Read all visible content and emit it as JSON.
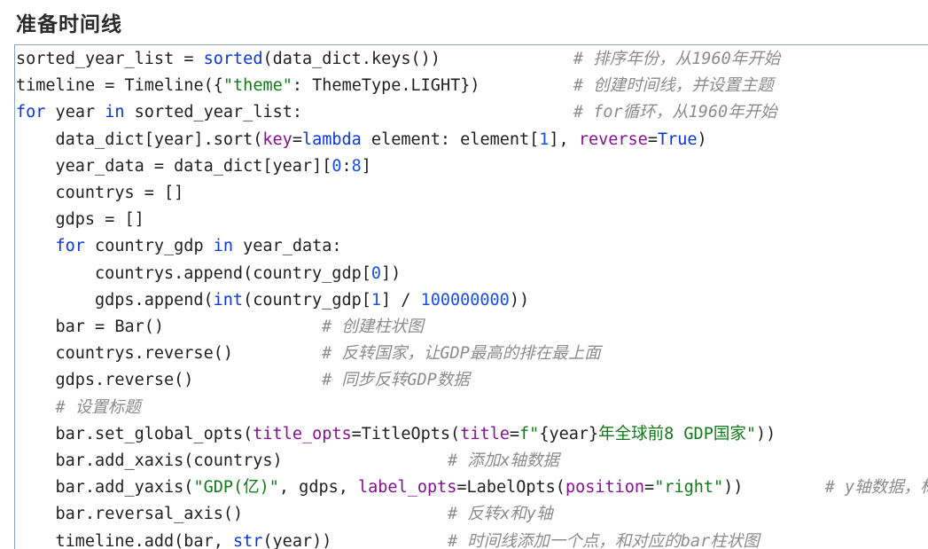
{
  "section_title": "准备时间线",
  "code_lines": [
    {
      "indent": 0,
      "tokens": [
        [
          "p",
          "sorted_year_list = "
        ],
        [
          "kw",
          "sorted"
        ],
        [
          "p",
          "(data_dict.keys())"
        ]
      ],
      "comment": "# 排序年份，从1960年开始",
      "comment_col": 65
    },
    {
      "indent": 0,
      "tokens": [
        [
          "p",
          "timeline = Timeline({"
        ],
        [
          "str",
          "\"theme\""
        ],
        [
          "p",
          ": ThemeType.LIGHT})"
        ]
      ],
      "comment": "# 创建时间线，并设置主题",
      "comment_col": 65
    },
    {
      "indent": 0,
      "tokens": [
        [
          "kw",
          "for"
        ],
        [
          "p",
          " year "
        ],
        [
          "kw",
          "in"
        ],
        [
          "p",
          " sorted_year_list:"
        ]
      ],
      "comment": "# for循环，从1960年开始",
      "comment_col": 65
    },
    {
      "indent": 1,
      "tokens": [
        [
          "p",
          "data_dict[year].sort("
        ],
        [
          "kwarg",
          "key"
        ],
        [
          "p",
          "="
        ],
        [
          "kw",
          "lambda"
        ],
        [
          "p",
          " element: element["
        ],
        [
          "num",
          "1"
        ],
        [
          "p",
          "], "
        ],
        [
          "kwarg",
          "reverse"
        ],
        [
          "p",
          "="
        ],
        [
          "kw",
          "True"
        ],
        [
          "p",
          ")"
        ]
      ],
      "comment": "",
      "comment_col": 0
    },
    {
      "indent": 1,
      "tokens": [
        [
          "p",
          "year_data = data_dict[year]["
        ],
        [
          "num",
          "0"
        ],
        [
          "p",
          ":"
        ],
        [
          "num",
          "8"
        ],
        [
          "p",
          "]"
        ]
      ],
      "comment": "",
      "comment_col": 0
    },
    {
      "indent": 1,
      "tokens": [
        [
          "p",
          "countrys = []"
        ]
      ],
      "comment": "",
      "comment_col": 0
    },
    {
      "indent": 1,
      "tokens": [
        [
          "p",
          "gdps = []"
        ]
      ],
      "comment": "",
      "comment_col": 0
    },
    {
      "indent": 1,
      "tokens": [
        [
          "kw",
          "for"
        ],
        [
          "p",
          " country_gdp "
        ],
        [
          "kw",
          "in"
        ],
        [
          "p",
          " year_data:"
        ]
      ],
      "comment": "",
      "comment_col": 0
    },
    {
      "indent": 2,
      "tokens": [
        [
          "p",
          "countrys.append(country_gdp["
        ],
        [
          "num",
          "0"
        ],
        [
          "p",
          "])"
        ]
      ],
      "comment": "",
      "comment_col": 0
    },
    {
      "indent": 2,
      "tokens": [
        [
          "p",
          "gdps.append("
        ],
        [
          "kw",
          "int"
        ],
        [
          "p",
          "(country_gdp["
        ],
        [
          "num",
          "1"
        ],
        [
          "p",
          "] / "
        ],
        [
          "num",
          "100000000"
        ],
        [
          "p",
          "))"
        ]
      ],
      "comment": "",
      "comment_col": 0
    },
    {
      "indent": 1,
      "tokens": [
        [
          "p",
          "bar = Bar()"
        ]
      ],
      "comment": "# 创建柱状图",
      "comment_col": 35
    },
    {
      "indent": 1,
      "tokens": [
        [
          "p",
          "countrys.reverse()"
        ]
      ],
      "comment": "# 反转国家，让GDP最高的排在最上面",
      "comment_col": 35
    },
    {
      "indent": 1,
      "tokens": [
        [
          "p",
          "gdps.reverse()"
        ]
      ],
      "comment": "# 同步反转GDP数据",
      "comment_col": 35
    },
    {
      "indent": 1,
      "tokens": [
        [
          "cmt",
          "# 设置标题"
        ]
      ],
      "comment": "",
      "comment_col": 0
    },
    {
      "indent": 1,
      "tokens": [
        [
          "p",
          "bar.set_global_opts("
        ],
        [
          "kwarg",
          "title_opts"
        ],
        [
          "p",
          "=TitleOpts("
        ],
        [
          "kwarg",
          "title"
        ],
        [
          "p",
          "="
        ],
        [
          "str",
          "f\""
        ],
        [
          "p",
          "{year}"
        ],
        [
          "str",
          "年全球前8 GDP国家\""
        ],
        [
          "p",
          "))"
        ]
      ],
      "comment": "",
      "comment_col": 0
    },
    {
      "indent": 1,
      "tokens": [
        [
          "p",
          "bar.add_xaxis(countrys)"
        ]
      ],
      "comment": "# 添加x轴数据",
      "comment_col": 50
    },
    {
      "indent": 1,
      "tokens": [
        [
          "p",
          "bar.add_yaxis("
        ],
        [
          "str",
          "\"GDP(亿)\""
        ],
        [
          "p",
          ", gdps, "
        ],
        [
          "kwarg",
          "label_opts"
        ],
        [
          "p",
          "=LabelOpts("
        ],
        [
          "kwarg",
          "position"
        ],
        [
          "p",
          "="
        ],
        [
          "str",
          "\"right\""
        ],
        [
          "p",
          "))"
        ]
      ],
      "comment": "# y轴数据，标签在右",
      "comment_col": 95
    },
    {
      "indent": 1,
      "tokens": [
        [
          "p",
          "bar.reversal_axis()"
        ]
      ],
      "comment": "# 反转x和y轴",
      "comment_col": 50
    },
    {
      "indent": 1,
      "tokens": [
        [
          "p",
          "timeline.add(bar, "
        ],
        [
          "kw",
          "str"
        ],
        [
          "p",
          "(year))"
        ]
      ],
      "comment": "# 时间线添加一个点，和对应的bar柱状图",
      "comment_col": 50
    }
  ],
  "colors": {
    "keyword": "#0a37d9",
    "string": "#117a1a",
    "number": "#1750eb",
    "kwarg": "#871094",
    "comment": "#8c8c8c",
    "plain": "#1f1f1f",
    "border": "#8aa4be"
  }
}
